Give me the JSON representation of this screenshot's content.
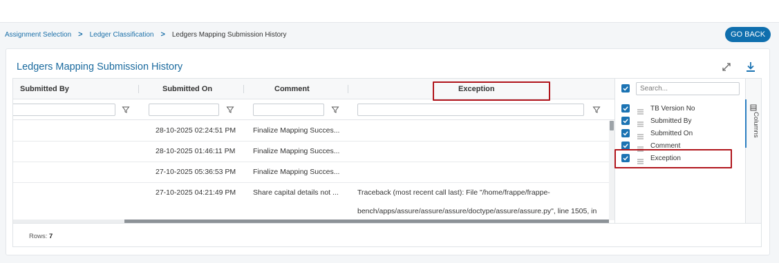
{
  "breadcrumb": {
    "items": [
      "Assignment Selection",
      "Ledger Classification",
      "Ledgers Mapping Submission History"
    ],
    "separator": ">"
  },
  "go_back": "GO BACK",
  "page_title": "Ledgers Mapping Submission History",
  "icons": {
    "expand": "expand-icon",
    "download": "download-icon",
    "filter": "filter-icon",
    "drag": "drag-handle-icon",
    "checkbox": "checkbox-checked-icon",
    "columns": "columns-icon"
  },
  "grid": {
    "columns": [
      "Submitted By",
      "Submitted On",
      "Comment",
      "Exception"
    ],
    "rows": [
      {
        "submitted_by": "",
        "submitted_on": "28-10-2025 02:24:51 PM",
        "comment": "Finalize Mapping Succes...",
        "exception": ""
      },
      {
        "submitted_by": "",
        "submitted_on": "28-10-2025 01:46:11 PM",
        "comment": "Finalize Mapping Succes...",
        "exception": ""
      },
      {
        "submitted_by": "",
        "submitted_on": "27-10-2025 05:36:53 PM",
        "comment": "Finalize Mapping Succes...",
        "exception": ""
      },
      {
        "submitted_by": "",
        "submitted_on": "27-10-2025 04:21:49 PM",
        "comment": "Share capital details not ...",
        "exception": "Traceback (most recent call last): File \"/home/frappe/frappe-",
        "exception_line2": "bench/apps/assure/assure/assure/doctype/assure/assure.py\", line 1505, in"
      }
    ],
    "status": {
      "rows_label": "Rows:",
      "rows_count": "7"
    }
  },
  "columns_panel": {
    "tab_label": "Columns",
    "search_placeholder": "Search...",
    "items": [
      "TB Version No",
      "Submitted By",
      "Submitted On",
      "Comment",
      "Exception"
    ]
  },
  "colors": {
    "accent": "#1b73b3",
    "title": "#1a6a9e",
    "highlight": "#b0141b",
    "go_back_bg": "#0f6fae"
  }
}
